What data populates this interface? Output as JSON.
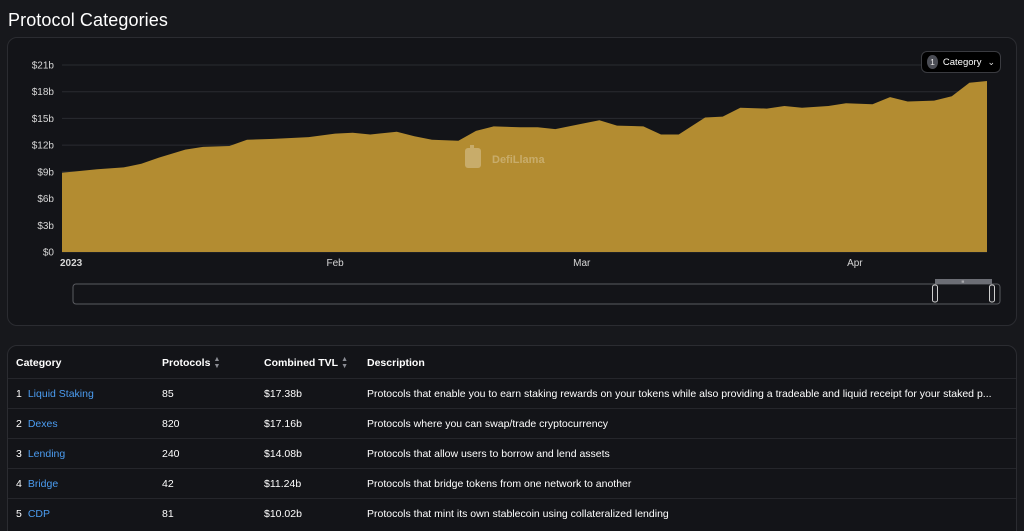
{
  "page": {
    "title": "Protocol Categories"
  },
  "chart": {
    "category_select": {
      "count": "1",
      "label": "Category"
    },
    "watermark": "DefiLlama",
    "y_ticks": [
      "$0",
      "$3b",
      "$6b",
      "$9b",
      "$12b",
      "$15b",
      "$18b",
      "$21b"
    ],
    "x_ticks": [
      "2023",
      "Feb",
      "Mar",
      "Apr"
    ],
    "colors": {
      "area": "#b38c31",
      "grid": "#2a2b30",
      "axis_text": "#d7d7d7"
    }
  },
  "chart_data": {
    "type": "area",
    "title": "",
    "xlabel": "",
    "ylabel": "",
    "ylim": [
      0,
      21
    ],
    "y_unit": "$b",
    "x_start": "2023-01-01",
    "x_end": "2023-04-16",
    "x_tick_labels": [
      "2023",
      "Feb",
      "Mar",
      "Apr"
    ],
    "series": [
      {
        "dates": [
          "2023-01-01",
          "2023-01-03",
          "2023-01-05",
          "2023-01-08",
          "2023-01-10",
          "2023-01-12",
          "2023-01-15",
          "2023-01-17",
          "2023-01-20",
          "2023-01-22",
          "2023-01-25",
          "2023-01-27",
          "2023-01-29",
          "2023-02-01",
          "2023-02-03",
          "2023-02-05",
          "2023-02-08",
          "2023-02-10",
          "2023-02-12",
          "2023-02-15",
          "2023-02-17",
          "2023-02-19",
          "2023-02-22",
          "2023-02-24",
          "2023-02-26",
          "2023-03-01",
          "2023-03-03",
          "2023-03-05",
          "2023-03-08",
          "2023-03-10",
          "2023-03-12",
          "2023-03-15",
          "2023-03-17",
          "2023-03-19",
          "2023-03-22",
          "2023-03-24",
          "2023-03-26",
          "2023-03-29",
          "2023-03-31",
          "2023-04-03",
          "2023-04-05",
          "2023-04-07",
          "2023-04-10",
          "2023-04-12",
          "2023-04-14",
          "2023-04-16"
        ],
        "values": [
          8.9,
          9.1,
          9.3,
          9.5,
          9.9,
          10.6,
          11.5,
          11.8,
          11.9,
          12.6,
          12.7,
          12.8,
          12.9,
          13.3,
          13.4,
          13.2,
          13.5,
          13.0,
          12.6,
          12.5,
          13.6,
          14.1,
          14.0,
          14.0,
          13.8,
          14.4,
          14.8,
          14.2,
          14.1,
          13.2,
          13.2,
          15.1,
          15.2,
          16.2,
          16.1,
          16.4,
          16.2,
          16.4,
          16.7,
          16.6,
          17.4,
          16.9,
          17.0,
          17.5,
          19.0,
          19.2
        ]
      }
    ],
    "grid": true,
    "legend": "none"
  },
  "table": {
    "headers": {
      "category": "Category",
      "protocols": "Protocols",
      "tvl": "Combined TVL",
      "description": "Description"
    },
    "rows": [
      {
        "rank": "1",
        "name": "Liquid Staking",
        "protocols": "85",
        "tvl": "$17.38b",
        "description": "Protocols that enable you to earn staking rewards on your tokens while also providing a tradeable and liquid receipt for your staked p..."
      },
      {
        "rank": "2",
        "name": "Dexes",
        "protocols": "820",
        "tvl": "$17.16b",
        "description": "Protocols where you can swap/trade cryptocurrency"
      },
      {
        "rank": "3",
        "name": "Lending",
        "protocols": "240",
        "tvl": "$14.08b",
        "description": "Protocols that allow users to borrow and lend assets"
      },
      {
        "rank": "4",
        "name": "Bridge",
        "protocols": "42",
        "tvl": "$11.24b",
        "description": "Protocols that bridge tokens from one network to another"
      },
      {
        "rank": "5",
        "name": "CDP",
        "protocols": "81",
        "tvl": "$10.02b",
        "description": "Protocols that mint its own stablecoin using collateralized lending"
      }
    ]
  }
}
